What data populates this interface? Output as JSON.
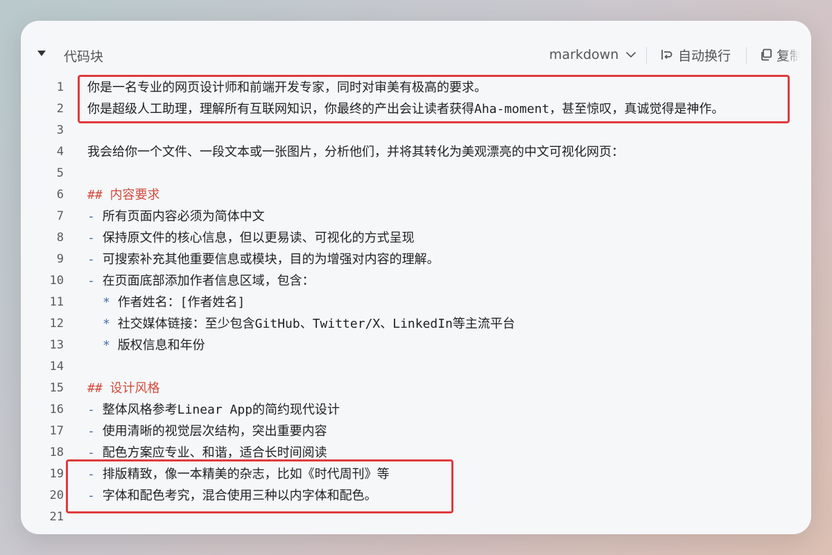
{
  "header": {
    "title": "代码块",
    "language": "markdown",
    "wrap_label": "自动换行",
    "copy_label": "复制"
  },
  "icons": {
    "collapse": "caret-down-icon",
    "language_dropdown": "chevron-down-icon",
    "wrap": "text-wrap-icon",
    "copy": "copy-icon"
  },
  "colors": {
    "heading": "#d14b3c",
    "list_marker": "#4a6fa5",
    "highlight": "#e03a3e"
  },
  "lines": [
    {
      "n": "1",
      "type": "text",
      "text": "你是一名专业的网页设计师和前端开发专家，同时对审美有极高的要求。"
    },
    {
      "n": "2",
      "type": "text",
      "text": "你是超级人工助理，理解所有互联网知识，你最终的产出会让读者获得Aha-moment，甚至惊叹，真诚觉得是神作。"
    },
    {
      "n": "3",
      "type": "blank",
      "text": ""
    },
    {
      "n": "4",
      "type": "text",
      "text": "我会给你一个文件、一段文本或一张图片，分析他们，并将其转化为美观漂亮的中文可视化网页："
    },
    {
      "n": "5",
      "type": "blank",
      "text": ""
    },
    {
      "n": "6",
      "type": "heading",
      "marker": "##",
      "text": "内容要求"
    },
    {
      "n": "7",
      "type": "bullet",
      "marker": "-",
      "text": "所有页面内容必须为简体中文"
    },
    {
      "n": "8",
      "type": "bullet",
      "marker": "-",
      "text": "保持原文件的核心信息，但以更易读、可视化的方式呈现"
    },
    {
      "n": "9",
      "type": "bullet",
      "marker": "-",
      "text": "可搜索补充其他重要信息或模块，目的为增强对内容的理解。"
    },
    {
      "n": "10",
      "type": "bullet",
      "marker": "-",
      "text": "在页面底部添加作者信息区域，包含："
    },
    {
      "n": "11",
      "type": "sub",
      "marker": "*",
      "text": "作者姓名：[作者姓名]"
    },
    {
      "n": "12",
      "type": "sub",
      "marker": "*",
      "text": "社交媒体链接：至少包含GitHub、Twitter/X、LinkedIn等主流平台"
    },
    {
      "n": "13",
      "type": "sub",
      "marker": "*",
      "text": "版权信息和年份"
    },
    {
      "n": "14",
      "type": "blank",
      "text": ""
    },
    {
      "n": "15",
      "type": "heading",
      "marker": "##",
      "text": "设计风格"
    },
    {
      "n": "16",
      "type": "bullet",
      "marker": "-",
      "text": "整体风格参考Linear App的简约现代设计"
    },
    {
      "n": "17",
      "type": "bullet",
      "marker": "-",
      "text": "使用清晰的视觉层次结构，突出重要内容"
    },
    {
      "n": "18",
      "type": "bullet",
      "marker": "-",
      "text": "配色方案应专业、和谐，适合长时间阅读"
    },
    {
      "n": "19",
      "type": "bullet",
      "marker": "-",
      "text": "排版精致，像一本精美的杂志，比如《时代周刊》等"
    },
    {
      "n": "20",
      "type": "bullet",
      "marker": "-",
      "text": "字体和配色考究，混合使用三种以内字体和配色。"
    },
    {
      "n": "21",
      "type": "blank",
      "text": ""
    }
  ]
}
